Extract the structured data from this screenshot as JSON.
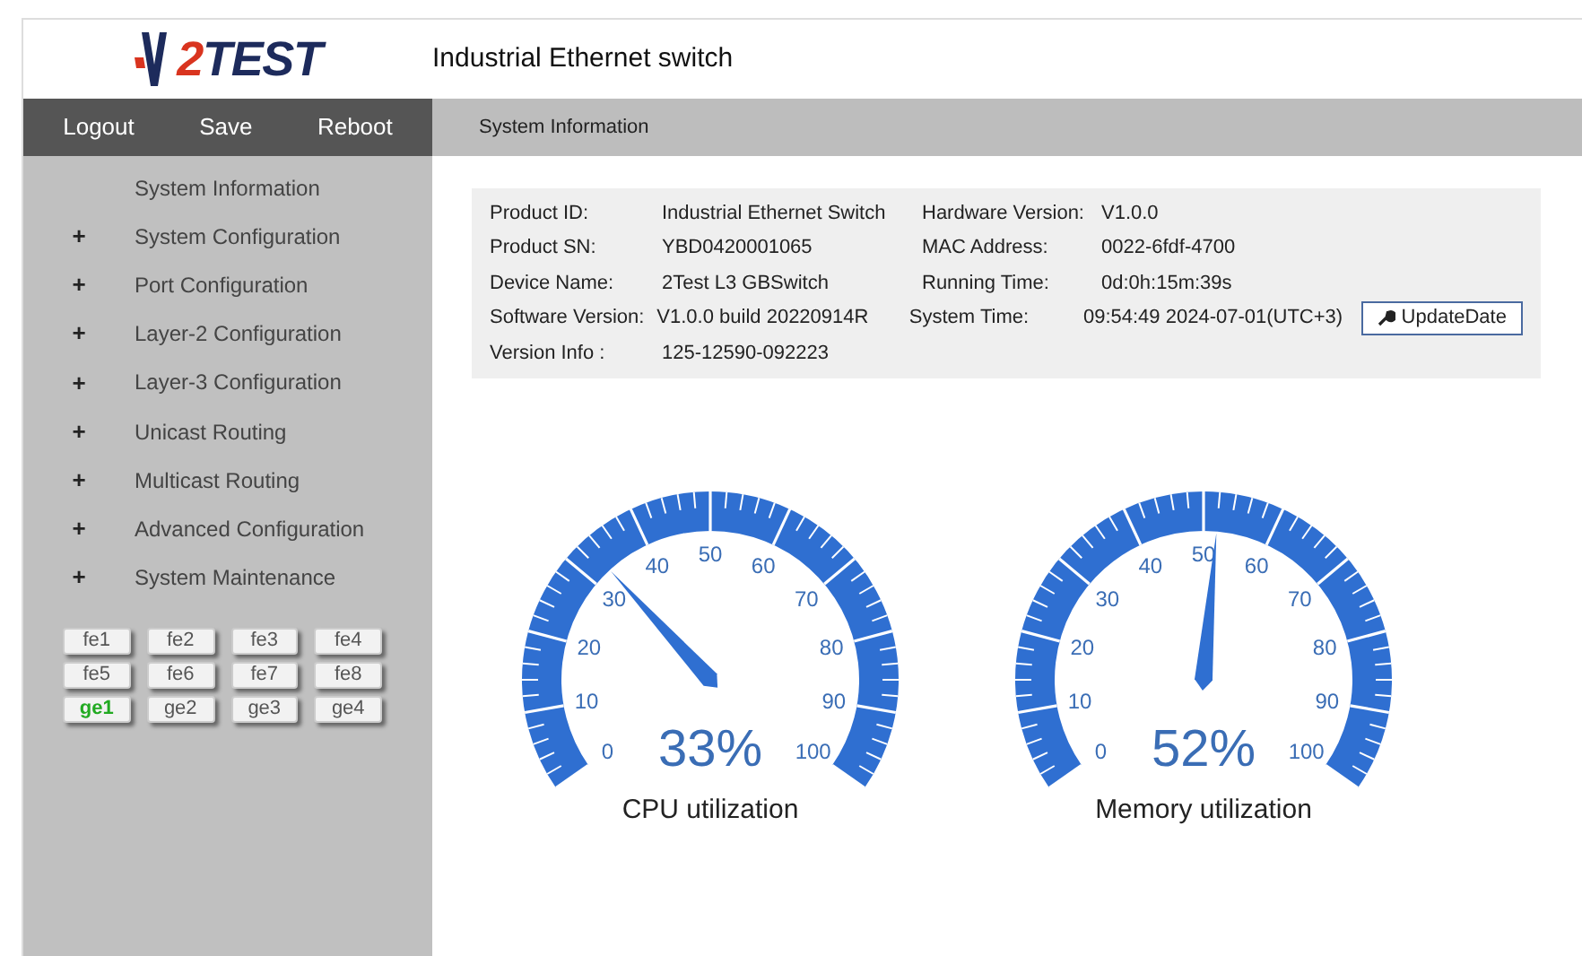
{
  "logo": {
    "mark": "2",
    "text": "TEST"
  },
  "header": {
    "title": "Industrial Ethernet switch"
  },
  "menu": [
    "Logout",
    "Save",
    "Reboot"
  ],
  "breadcrumb": "System Information",
  "sidebar": {
    "items": [
      {
        "label": "System Information"
      },
      {
        "label": "System Configuration",
        "expander": "+"
      },
      {
        "label": "Port Configuration",
        "expander": "+"
      },
      {
        "label": "Layer-2 Configuration",
        "expander": "+"
      },
      {
        "label": "Layer-3 Configuration",
        "expander": "+"
      },
      {
        "label": "Unicast Routing",
        "expander": "+"
      },
      {
        "label": "Multicast Routing",
        "expander": "+"
      },
      {
        "label": "Advanced Configuration",
        "expander": "+"
      },
      {
        "label": "System Maintenance",
        "expander": "+"
      }
    ]
  },
  "ports": [
    {
      "label": "fe1",
      "selected": false
    },
    {
      "label": "fe2",
      "selected": false
    },
    {
      "label": "fe3",
      "selected": false
    },
    {
      "label": "fe4",
      "selected": false
    },
    {
      "label": "fe5",
      "selected": false
    },
    {
      "label": "fe6",
      "selected": false
    },
    {
      "label": "fe7",
      "selected": false
    },
    {
      "label": "fe8",
      "selected": false
    },
    {
      "label": "ge1",
      "selected": true
    },
    {
      "label": "ge2",
      "selected": false
    },
    {
      "label": "ge3",
      "selected": false
    },
    {
      "label": "ge4",
      "selected": false
    }
  ],
  "info": {
    "rows": [
      [
        {
          "label": "Product ID:",
          "value": "Industrial Ethernet Switch"
        },
        {
          "label": "Hardware Version:",
          "value": "V1.0.0"
        }
      ],
      [
        {
          "label": "Product SN:",
          "value": "YBD0420001065"
        },
        {
          "label": "MAC Address:",
          "value": "0022-6fdf-4700"
        }
      ],
      [
        {
          "label": "Device Name:",
          "value": "2Test L3 GBSwitch"
        },
        {
          "label": "Running Time:",
          "value": "0d:0h:15m:39s"
        }
      ],
      [
        {
          "label": "Software Version:",
          "value": "V1.0.0 build 20220914R"
        },
        {
          "label": "System Time:",
          "value": "09:54:49 2024-07-01(UTC+3)"
        }
      ],
      [
        {
          "label": "Version Info :",
          "value": "125-12590-092223"
        }
      ]
    ],
    "button": "UpdateDate"
  },
  "gauges": [
    {
      "title": "CPU utilization",
      "reading": "33%",
      "level": 0.33,
      "ticks": [
        "0",
        "10",
        "20",
        "30",
        "40",
        "50",
        "60",
        "70",
        "80",
        "90",
        "100"
      ]
    },
    {
      "title": "Memory utilization",
      "reading": "52%",
      "level": 0.52,
      "ticks": [
        "0",
        "10",
        "20",
        "30",
        "40",
        "50",
        "60",
        "70",
        "80",
        "90",
        "100"
      ]
    }
  ]
}
